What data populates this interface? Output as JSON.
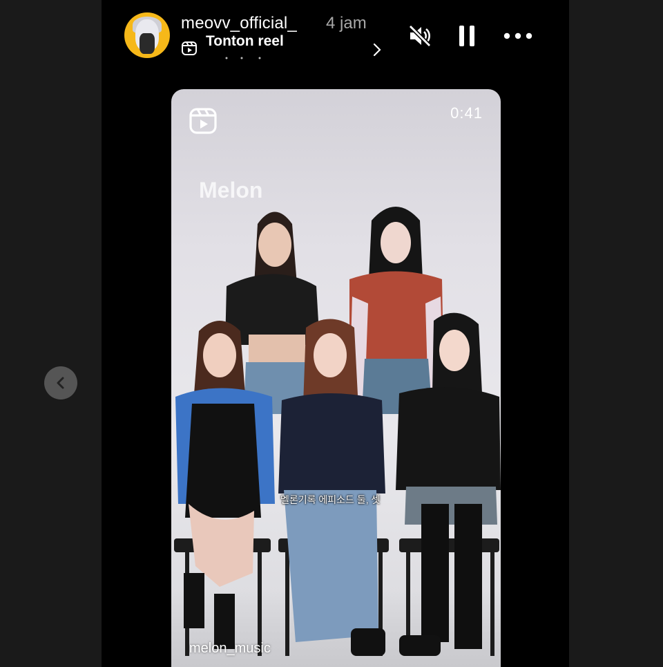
{
  "header": {
    "username": "meovv_official_",
    "time_ago": "4 jam",
    "reel_label": "Tonton reel"
  },
  "icons": {
    "avatar": "profile-avatar",
    "reel": "reels-icon",
    "chevron": "chevron-right-icon",
    "mute": "speaker-muted-icon",
    "pause": "pause-icon",
    "more": "more-horizontal-icon",
    "prev": "chevron-left-icon"
  },
  "reel_card": {
    "duration": "0:41",
    "watermark": "Melon",
    "caption": "멜론기록 에피소드 둘, 셋",
    "credit": "melon_music"
  },
  "colors": {
    "background": "#1a1a1a",
    "story_frame": "#000000",
    "avatar_ring": "#f6b819",
    "secondary_text": "#a9a9a9"
  }
}
